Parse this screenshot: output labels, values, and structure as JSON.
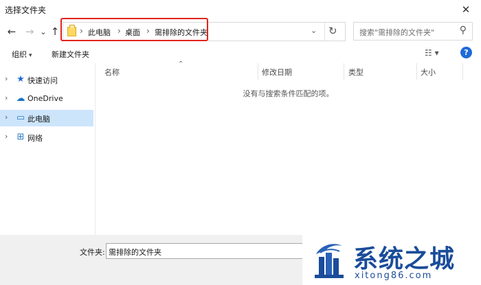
{
  "window": {
    "title": "选择文件夹",
    "close_glyph": "✕"
  },
  "navigation": {
    "back_glyph": "←",
    "forward_glyph": "→",
    "recent_glyph": "⌄",
    "up_glyph": "↑"
  },
  "address_bar": {
    "breadcrumb": [
      "此电脑",
      "桌面",
      "需排除的文件夹"
    ],
    "separator_glyph": "›",
    "dropdown_glyph": "⌄",
    "refresh_glyph": "↻",
    "highlight_color": "#e0221b"
  },
  "search": {
    "placeholder": "搜索\"需排除的文件夹\"",
    "icon_glyph": "⚲"
  },
  "toolbar": {
    "organize_label": "组织",
    "organize_caret": "▾",
    "new_folder_label": "新建文件夹",
    "view_glyph": "☷ ▾",
    "help_glyph": "?"
  },
  "sidebar": {
    "items": [
      {
        "label": "快速访问",
        "icon": "star-icon",
        "glyph": "★",
        "color": "#1f6bd6"
      },
      {
        "label": "OneDrive",
        "icon": "cloud-icon",
        "glyph": "☁",
        "color": "#1a73c9"
      },
      {
        "label": "此电脑",
        "icon": "computer-icon",
        "glyph": "▭",
        "color": "#2b79c2"
      },
      {
        "label": "网络",
        "icon": "network-icon",
        "glyph": "⊞",
        "color": "#2b79c2"
      }
    ],
    "chevron_glyph": "›"
  },
  "file_list": {
    "columns": [
      "名称",
      "修改日期",
      "类型",
      "大小"
    ],
    "sort_glyph": "⌃",
    "empty_message": "没有与搜索条件匹配的项。"
  },
  "bottom": {
    "folder_label": "文件夹:",
    "folder_value": "需排除的文件夹"
  },
  "watermark": {
    "text": "系统之城",
    "url": "xitong86.com",
    "color": "#1a4c9a"
  }
}
